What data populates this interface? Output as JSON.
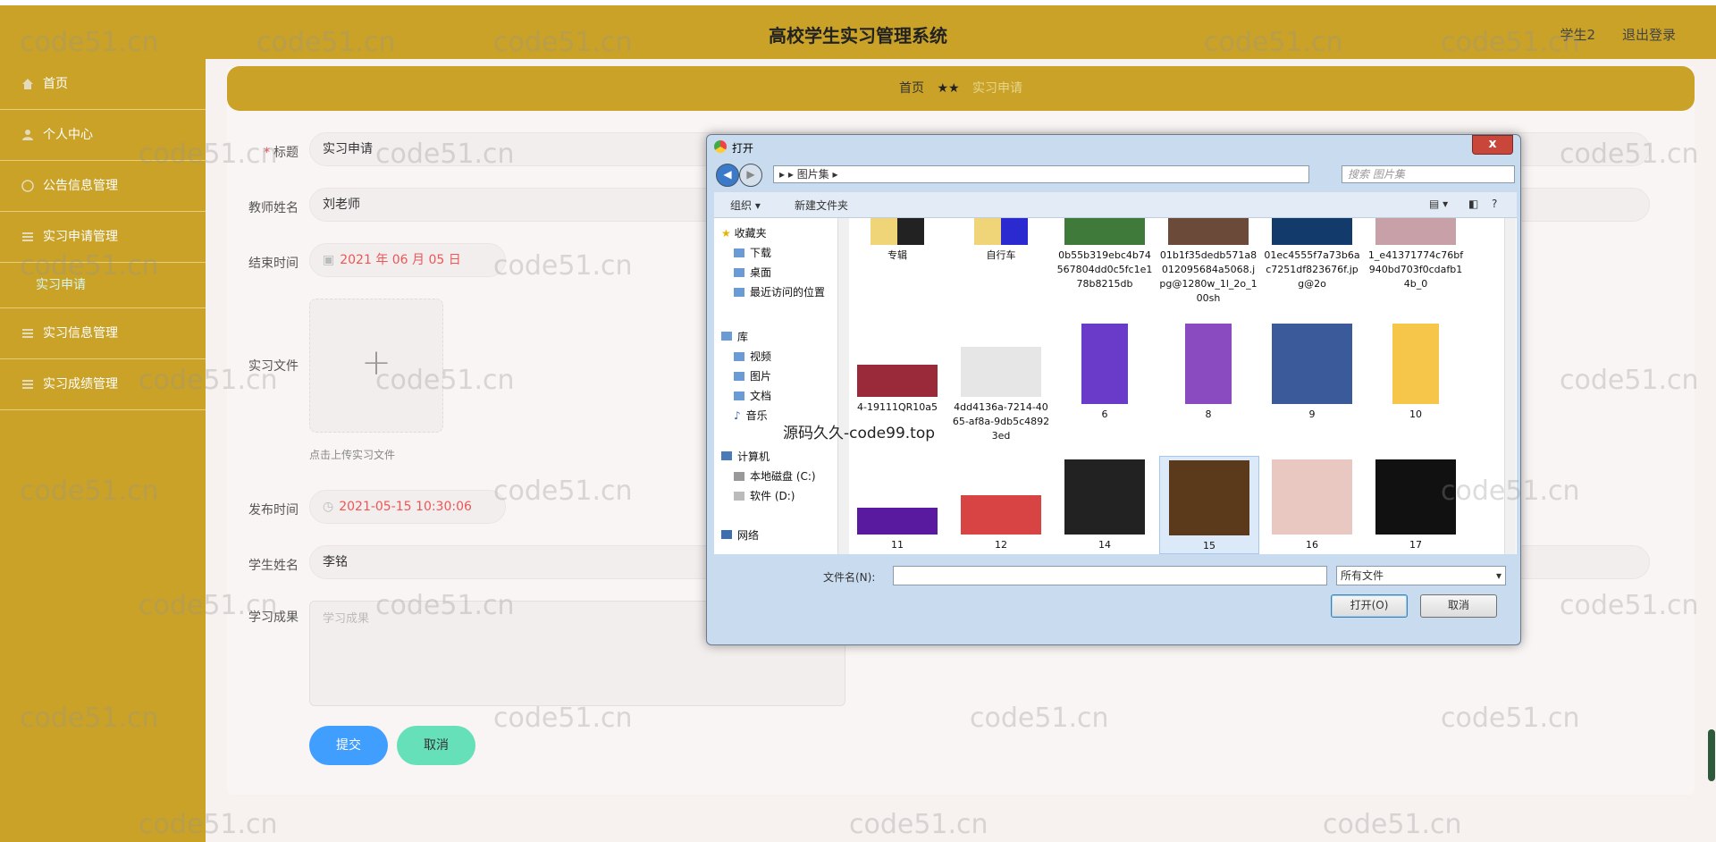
{
  "header": {
    "title": "高校学生实习管理系统",
    "user": "学生2",
    "logout": "退出登录"
  },
  "sidebar": {
    "items": [
      {
        "label": "首页"
      },
      {
        "label": "个人中心"
      },
      {
        "label": "公告信息管理"
      },
      {
        "label": "实习申请管理"
      }
    ],
    "sub_item": "实习申请",
    "items_after": [
      {
        "label": "实习信息管理"
      },
      {
        "label": "实习成绩管理"
      }
    ]
  },
  "breadcrumb": {
    "home": "首页",
    "sep": "★★",
    "current": "实习申请"
  },
  "form": {
    "title_label": "标题",
    "title_value": "实习申请",
    "teacher_label": "教师姓名",
    "teacher_value": "刘老师",
    "end_label": "结束时间",
    "end_value": "2021 年 06 月 05 日",
    "file_label": "实习文件",
    "file_hint": "点击上传实习文件",
    "publish_label": "发布时间",
    "publish_value": "2021-05-15 10:30:06",
    "student_label": "学生姓名",
    "student_value": "李铭",
    "result_label": "学习成果",
    "result_placeholder": "学习成果",
    "submit": "提交",
    "cancel": "取消"
  },
  "dialog": {
    "title": "打开",
    "close": "x",
    "address": "图片集",
    "search_placeholder": "搜索 图片集",
    "toolbar": {
      "organize": "组织 ▾",
      "new_folder": "新建文件夹"
    },
    "nav": {
      "favorites": "收藏夹",
      "downloads": "下载",
      "desktop": "桌面",
      "recent": "最近访问的位置",
      "library": "库",
      "videos": "视频",
      "pictures": "图片",
      "documents": "文档",
      "music": "音乐",
      "computer": "计算机",
      "disk_c": "本地磁盘 (C:)",
      "disk_d": "软件 (D:)",
      "network": "网络"
    },
    "files_row1": [
      "专辑",
      "自行车",
      "0b55b319ebc4b74567804dd0c5fc1e178b8215db",
      "01b1f35dedb571a8012095684a5068.jpg@1280w_1l_2o_100sh",
      "01ec4555f7a73b6ac7251df823676f.jpg@2o",
      "1_e41371774c76bf940bd703f0cdafb14b_0"
    ],
    "files_row2": [
      "4-19111QR10a5",
      "4dd4136a-7214-4065-af8a-9db5c48923ed",
      "6",
      "8",
      "9",
      "10"
    ],
    "files_row3": [
      "11",
      "12",
      "14",
      "15",
      "16",
      "17"
    ],
    "filename_label": "文件名(N):",
    "type_value": "所有文件",
    "open_btn": "打开(O)",
    "cancel_btn": "取消"
  },
  "overlay_note": "源码久久-code99.top",
  "watermark": "code51.cn",
  "colors": {
    "accent": "#c9a227",
    "submit": "#409eff",
    "cancel": "#66e0b8",
    "date_text": "#e55555"
  }
}
